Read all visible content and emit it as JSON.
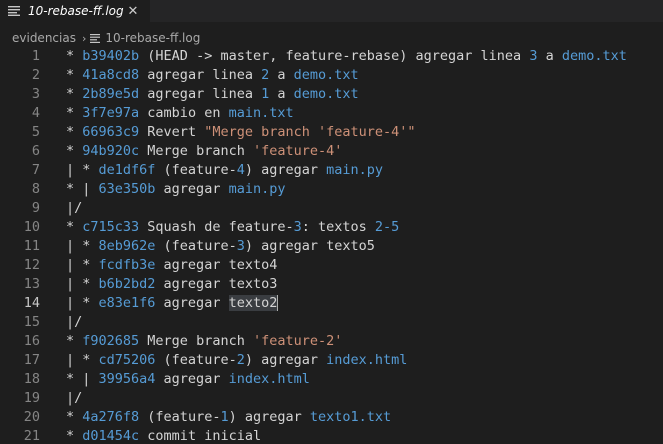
{
  "tab": {
    "title": "10-rebase-ff.log",
    "close_glyph": "✕",
    "icon": "lines-icon"
  },
  "breadcrumb": {
    "folder": "evidencias",
    "separator": "›",
    "file": "10-rebase-ff.log",
    "icon": "lines-icon"
  },
  "colors": {
    "background": "#1e1e1e",
    "hash": "#569cd6",
    "string": "#ce9178",
    "text": "#d4d4d4",
    "gutter": "#858585"
  },
  "cursor_line": 14,
  "lines": [
    {
      "n": "1",
      "segs": [
        [
          "t",
          "* "
        ],
        [
          "h",
          "b39402b"
        ],
        [
          "t",
          " (HEAD -> master, feature-rebase) agregar linea "
        ],
        [
          "h",
          "3"
        ],
        [
          "t",
          " a "
        ],
        [
          "h",
          "demo.txt"
        ]
      ]
    },
    {
      "n": "2",
      "segs": [
        [
          "t",
          "* "
        ],
        [
          "h",
          "41a8cd8"
        ],
        [
          "t",
          " agregar linea "
        ],
        [
          "h",
          "2"
        ],
        [
          "t",
          " a "
        ],
        [
          "h",
          "demo.txt"
        ]
      ]
    },
    {
      "n": "3",
      "segs": [
        [
          "t",
          "* "
        ],
        [
          "h",
          "2b89e5d"
        ],
        [
          "t",
          " agregar linea "
        ],
        [
          "h",
          "1"
        ],
        [
          "t",
          " a "
        ],
        [
          "h",
          "demo.txt"
        ]
      ]
    },
    {
      "n": "4",
      "segs": [
        [
          "t",
          "* "
        ],
        [
          "h",
          "3f7e97a"
        ],
        [
          "t",
          " cambio en "
        ],
        [
          "h",
          "main.txt"
        ]
      ]
    },
    {
      "n": "5",
      "segs": [
        [
          "t",
          "* "
        ],
        [
          "h",
          "66963c9"
        ],
        [
          "t",
          " Revert "
        ],
        [
          "s",
          "\"Merge branch 'feature-4'\""
        ]
      ]
    },
    {
      "n": "6",
      "segs": [
        [
          "t",
          "* "
        ],
        [
          "h",
          "94b920c"
        ],
        [
          "t",
          " Merge branch "
        ],
        [
          "s",
          "'feature-4'"
        ]
      ]
    },
    {
      "n": "7",
      "segs": [
        [
          "t",
          "| * "
        ],
        [
          "h",
          "de1df6f"
        ],
        [
          "t",
          " (feature-"
        ],
        [
          "h",
          "4"
        ],
        [
          "t",
          ") agregar "
        ],
        [
          "h",
          "main.py"
        ]
      ]
    },
    {
      "n": "8",
      "segs": [
        [
          "t",
          "* | "
        ],
        [
          "h",
          "63e350b"
        ],
        [
          "t",
          " agregar "
        ],
        [
          "h",
          "main.py"
        ]
      ]
    },
    {
      "n": "9",
      "segs": [
        [
          "t",
          "|/"
        ]
      ]
    },
    {
      "n": "10",
      "segs": [
        [
          "t",
          "* "
        ],
        [
          "h",
          "c715c33"
        ],
        [
          "t",
          " Squash de feature-"
        ],
        [
          "h",
          "3"
        ],
        [
          "t",
          ": textos "
        ],
        [
          "h",
          "2-5"
        ]
      ]
    },
    {
      "n": "11",
      "segs": [
        [
          "t",
          "| * "
        ],
        [
          "h",
          "8eb962e"
        ],
        [
          "t",
          " (feature-"
        ],
        [
          "h",
          "3"
        ],
        [
          "t",
          ") agregar texto5"
        ]
      ]
    },
    {
      "n": "12",
      "segs": [
        [
          "t",
          "| * "
        ],
        [
          "h",
          "fcdfb3e"
        ],
        [
          "t",
          " agregar texto4"
        ]
      ]
    },
    {
      "n": "13",
      "segs": [
        [
          "t",
          "| * "
        ],
        [
          "h",
          "b6b2bd2"
        ],
        [
          "t",
          " agregar texto3"
        ]
      ]
    },
    {
      "n": "14",
      "segs": [
        [
          "t",
          "| * "
        ],
        [
          "h",
          "e83e1f6"
        ],
        [
          "t",
          " agregar "
        ],
        [
          "x",
          "texto2"
        ],
        [
          "c",
          ""
        ]
      ]
    },
    {
      "n": "15",
      "segs": [
        [
          "t",
          "|/"
        ]
      ]
    },
    {
      "n": "16",
      "segs": [
        [
          "t",
          "* "
        ],
        [
          "h",
          "f902685"
        ],
        [
          "t",
          " Merge branch "
        ],
        [
          "s",
          "'feature-2'"
        ]
      ]
    },
    {
      "n": "17",
      "segs": [
        [
          "t",
          "| * "
        ],
        [
          "h",
          "cd75206"
        ],
        [
          "t",
          " (feature-"
        ],
        [
          "h",
          "2"
        ],
        [
          "t",
          ") agregar "
        ],
        [
          "h",
          "index.html"
        ]
      ]
    },
    {
      "n": "18",
      "segs": [
        [
          "t",
          "* | "
        ],
        [
          "h",
          "39956a4"
        ],
        [
          "t",
          " agregar "
        ],
        [
          "h",
          "index.html"
        ]
      ]
    },
    {
      "n": "19",
      "segs": [
        [
          "t",
          "|/"
        ]
      ]
    },
    {
      "n": "20",
      "segs": [
        [
          "t",
          "* "
        ],
        [
          "h",
          "4a276f8"
        ],
        [
          "t",
          " (feature-"
        ],
        [
          "h",
          "1"
        ],
        [
          "t",
          ") agregar "
        ],
        [
          "h",
          "texto1.txt"
        ]
      ]
    },
    {
      "n": "21",
      "segs": [
        [
          "t",
          "* "
        ],
        [
          "h",
          "d01454c"
        ],
        [
          "t",
          " commit inicial"
        ]
      ]
    }
  ]
}
